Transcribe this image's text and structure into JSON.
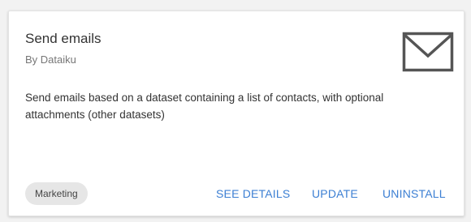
{
  "plugin": {
    "title": "Send emails",
    "author": "By Dataiku",
    "description": "Send emails based on a dataset containing a list of contacts, with optional attachments (other datasets)",
    "icon": "envelope-icon",
    "tag": "Marketing"
  },
  "actions": {
    "see_details": "SEE DETAILS",
    "update": "UPDATE",
    "uninstall": "UNINSTALL"
  },
  "colors": {
    "accent": "#3c7fd3",
    "icon": "#555555",
    "tag_bg": "#e6e6e6"
  }
}
